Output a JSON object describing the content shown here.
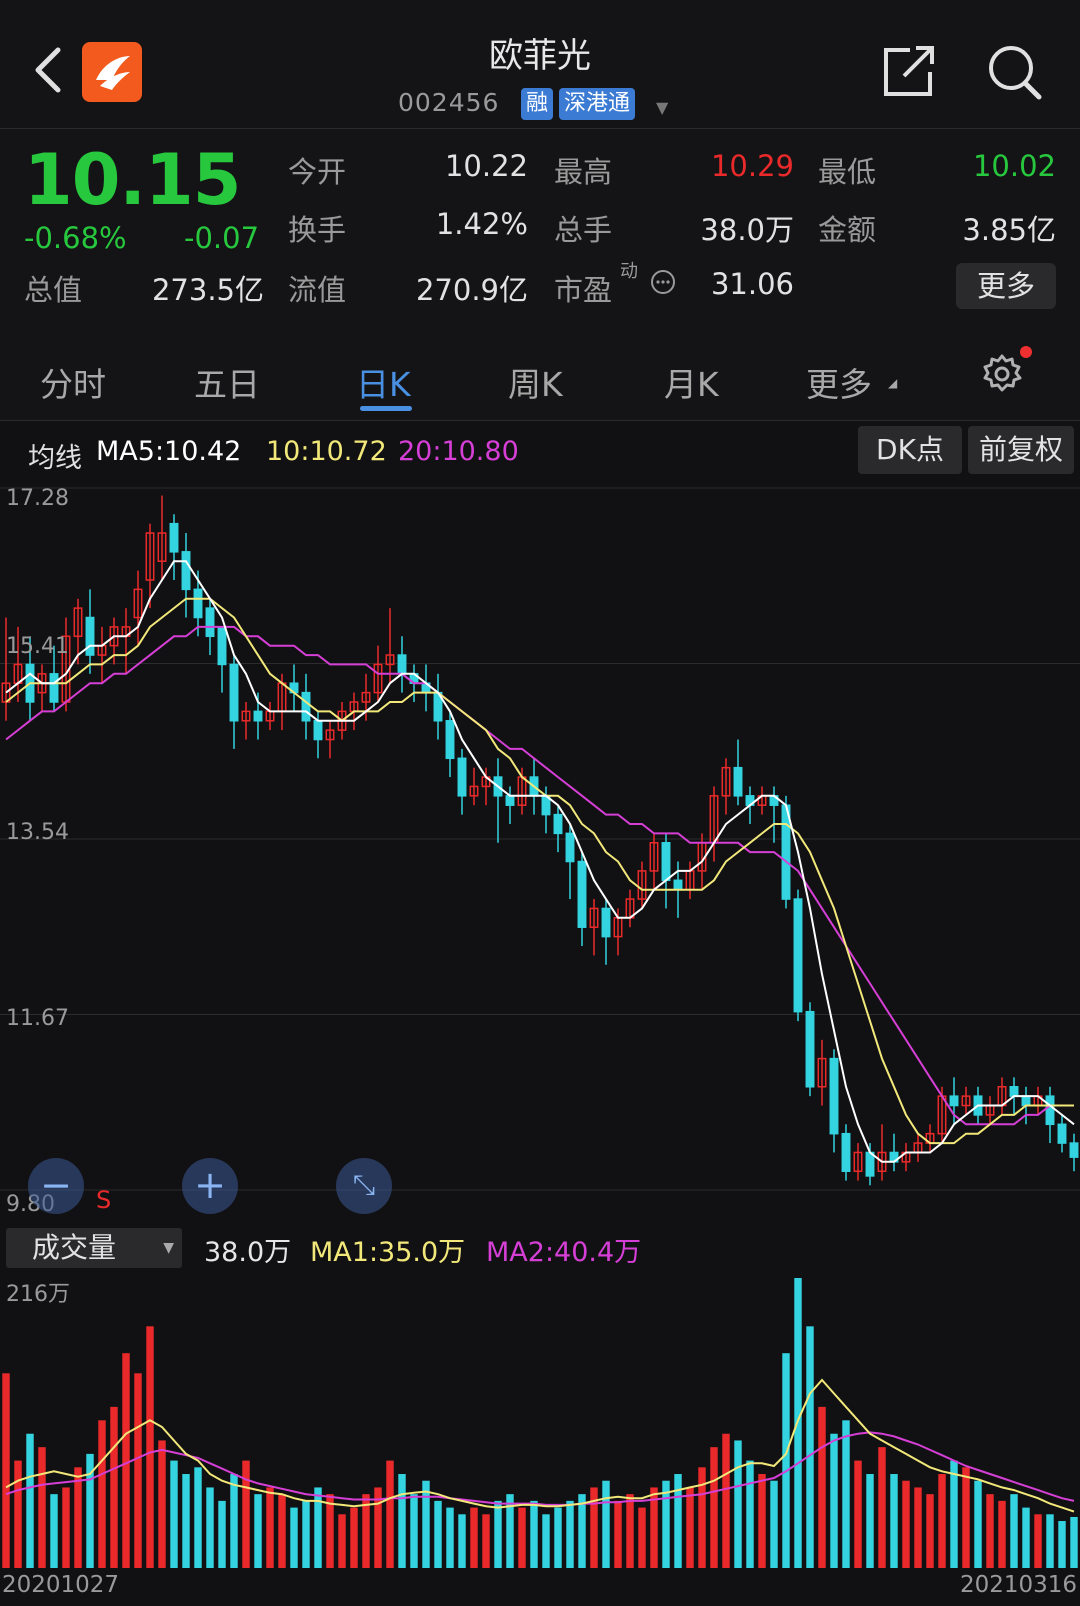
{
  "header": {
    "title": "欧菲光",
    "code": "002456",
    "tags": [
      "融",
      "深港通"
    ],
    "icons": [
      "back-arrow-icon",
      "app-logo-icon",
      "share-icon",
      "search-icon"
    ]
  },
  "quote": {
    "price": "10.15",
    "change_pct": "-0.68%",
    "change": "-0.07",
    "fields": {
      "open_label": "今开",
      "open": "10.22",
      "high_label": "最高",
      "high": "10.29",
      "low_label": "最低",
      "low": "10.02",
      "turnover_label": "换手",
      "turnover": "1.42%",
      "volume_label": "总手",
      "volume": "38.0万",
      "amount_label": "金额",
      "amount": "3.85亿",
      "mcap_label": "总值",
      "mcap": "273.5亿",
      "float_label": "流值",
      "float": "270.9亿",
      "pe_label": "市盈",
      "pe_sup": "动",
      "pe": "31.06"
    },
    "more_label": "更多"
  },
  "tabs": {
    "items": [
      "分时",
      "五日",
      "日K",
      "周K",
      "月K",
      "更多"
    ],
    "active": "日K"
  },
  "ma": {
    "label": "均线",
    "ma5": "MA5:10.42",
    "ma10": "10:10.72",
    "ma20": "20:10.80",
    "dk_label": "DK点",
    "adj_label": "前复权"
  },
  "colors": {
    "up": "#ea2a2a",
    "down": "#33d3e0",
    "ma5": "#ffffff",
    "ma10": "#f2e87a",
    "ma20": "#d63fd6",
    "price_down": "#27c83e"
  },
  "chart_data": [
    {
      "type": "candlestick",
      "y_ticks": [
        "17.28",
        "15.41",
        "13.54",
        "11.67",
        "9.80"
      ],
      "ylim": [
        9.8,
        17.28
      ],
      "candles": [
        [
          15.0,
          15.9,
          15.2,
          14.8
        ],
        [
          15.2,
          15.8,
          15.4,
          15.0
        ],
        [
          15.4,
          15.7,
          15.0,
          14.8
        ],
        [
          15.1,
          15.4,
          15.3,
          14.9
        ],
        [
          15.3,
          15.6,
          15.0,
          14.9
        ],
        [
          15.0,
          15.9,
          15.7,
          14.9
        ],
        [
          15.7,
          16.1,
          16.0,
          15.4
        ],
        [
          15.9,
          16.2,
          15.5,
          15.3
        ],
        [
          15.5,
          15.8,
          15.6,
          15.2
        ],
        [
          15.6,
          15.9,
          15.8,
          15.4
        ],
        [
          15.7,
          16.0,
          15.8,
          15.3
        ],
        [
          15.9,
          16.4,
          16.2,
          15.6
        ],
        [
          16.3,
          16.9,
          16.8,
          16.0
        ],
        [
          16.5,
          17.2,
          16.8,
          16.3
        ],
        [
          16.9,
          17.0,
          16.6,
          16.3
        ],
        [
          16.6,
          16.8,
          16.2,
          15.9
        ],
        [
          16.2,
          16.4,
          15.9,
          15.7
        ],
        [
          16.0,
          16.1,
          15.7,
          15.5
        ],
        [
          15.8,
          15.8,
          15.4,
          15.1
        ],
        [
          15.4,
          15.5,
          14.8,
          14.5
        ],
        [
          14.8,
          15.0,
          14.9,
          14.6
        ],
        [
          14.9,
          15.1,
          14.8,
          14.6
        ],
        [
          14.8,
          15.0,
          14.9,
          14.7
        ],
        [
          14.9,
          15.3,
          15.2,
          14.7
        ],
        [
          15.2,
          15.4,
          15.1,
          14.9
        ],
        [
          15.1,
          15.3,
          14.8,
          14.6
        ],
        [
          14.8,
          14.9,
          14.6,
          14.4
        ],
        [
          14.6,
          14.8,
          14.7,
          14.4
        ],
        [
          14.7,
          15.0,
          14.9,
          14.6
        ],
        [
          14.9,
          15.1,
          15.0,
          14.7
        ],
        [
          15.0,
          15.3,
          15.1,
          14.8
        ],
        [
          15.1,
          15.6,
          15.4,
          15.0
        ],
        [
          15.4,
          16.0,
          15.5,
          15.2
        ],
        [
          15.5,
          15.7,
          15.3,
          15.1
        ],
        [
          15.3,
          15.4,
          15.2,
          15.0
        ],
        [
          15.2,
          15.4,
          15.1,
          14.9
        ],
        [
          15.1,
          15.3,
          14.8,
          14.6
        ],
        [
          14.8,
          14.9,
          14.4,
          14.2
        ],
        [
          14.4,
          14.5,
          14.0,
          13.8
        ],
        [
          14.0,
          14.3,
          14.1,
          13.9
        ],
        [
          14.1,
          14.3,
          14.2,
          13.9
        ],
        [
          14.2,
          14.4,
          14.0,
          13.5
        ],
        [
          14.0,
          14.1,
          13.9,
          13.7
        ],
        [
          13.9,
          14.3,
          14.2,
          13.8
        ],
        [
          14.2,
          14.4,
          14.0,
          13.8
        ],
        [
          14.0,
          14.1,
          13.8,
          13.6
        ],
        [
          13.8,
          13.9,
          13.6,
          13.4
        ],
        [
          13.6,
          13.7,
          13.3,
          12.9
        ],
        [
          13.3,
          13.4,
          12.6,
          12.4
        ],
        [
          12.6,
          12.9,
          12.8,
          12.3
        ],
        [
          12.8,
          12.9,
          12.5,
          12.2
        ],
        [
          12.5,
          12.8,
          12.7,
          12.3
        ],
        [
          12.7,
          13.0,
          12.9,
          12.6
        ],
        [
          12.9,
          13.3,
          13.2,
          12.8
        ],
        [
          13.2,
          13.6,
          13.5,
          13.0
        ],
        [
          13.5,
          13.6,
          13.1,
          12.8
        ],
        [
          13.1,
          13.3,
          13.0,
          12.7
        ],
        [
          13.0,
          13.3,
          13.2,
          12.9
        ],
        [
          13.2,
          13.6,
          13.5,
          13.0
        ],
        [
          13.5,
          14.1,
          14.0,
          13.3
        ],
        [
          14.0,
          14.4,
          14.3,
          13.8
        ],
        [
          14.3,
          14.6,
          14.0,
          13.9
        ],
        [
          14.0,
          14.1,
          13.9,
          13.7
        ],
        [
          13.9,
          14.1,
          14.0,
          13.8
        ],
        [
          14.0,
          14.1,
          13.9,
          13.5
        ],
        [
          13.9,
          14.0,
          12.9,
          12.8
        ],
        [
          12.9,
          13.0,
          11.7,
          11.6
        ],
        [
          11.7,
          11.8,
          10.9,
          10.8
        ],
        [
          10.9,
          11.4,
          11.2,
          10.7
        ],
        [
          11.2,
          11.3,
          10.4,
          10.2
        ],
        [
          10.4,
          10.5,
          10.0,
          9.9
        ],
        [
          10.0,
          10.3,
          10.2,
          9.9
        ],
        [
          10.2,
          10.3,
          9.95,
          9.85
        ],
        [
          10.0,
          10.5,
          10.2,
          9.9
        ],
        [
          10.2,
          10.4,
          10.1,
          10.0
        ],
        [
          10.1,
          10.3,
          10.2,
          10.0
        ],
        [
          10.2,
          10.4,
          10.3,
          10.1
        ],
        [
          10.3,
          10.5,
          10.4,
          10.2
        ],
        [
          10.4,
          10.9,
          10.8,
          10.3
        ],
        [
          10.8,
          11.0,
          10.7,
          10.5
        ],
        [
          10.7,
          10.9,
          10.8,
          10.6
        ],
        [
          10.8,
          10.9,
          10.6,
          10.5
        ],
        [
          10.6,
          10.8,
          10.7,
          10.5
        ],
        [
          10.7,
          11.0,
          10.9,
          10.6
        ],
        [
          10.9,
          11.0,
          10.8,
          10.6
        ],
        [
          10.8,
          10.9,
          10.7,
          10.5
        ],
        [
          10.7,
          10.9,
          10.8,
          10.6
        ],
        [
          10.8,
          10.9,
          10.5,
          10.3
        ],
        [
          10.5,
          10.6,
          10.3,
          10.2
        ],
        [
          10.3,
          10.4,
          10.15,
          10.0
        ]
      ],
      "ma5": [
        15.1,
        15.2,
        15.3,
        15.2,
        15.2,
        15.3,
        15.5,
        15.6,
        15.6,
        15.7,
        15.7,
        15.8,
        16.1,
        16.3,
        16.5,
        16.5,
        16.3,
        16.1,
        15.9,
        15.5,
        15.3,
        15.0,
        14.9,
        14.9,
        14.9,
        14.9,
        14.8,
        14.8,
        14.8,
        14.8,
        14.9,
        15.0,
        15.2,
        15.3,
        15.3,
        15.2,
        15.1,
        14.9,
        14.6,
        14.4,
        14.2,
        14.1,
        14.0,
        14.0,
        14.0,
        14.0,
        13.9,
        13.7,
        13.4,
        13.1,
        12.9,
        12.7,
        12.7,
        12.8,
        13.0,
        13.1,
        13.2,
        13.2,
        13.3,
        13.5,
        13.7,
        13.8,
        13.9,
        14.0,
        14.0,
        13.9,
        13.4,
        12.8,
        12.1,
        11.5,
        10.9,
        10.5,
        10.2,
        10.1,
        10.1,
        10.2,
        10.2,
        10.2,
        10.3,
        10.5,
        10.6,
        10.7,
        10.7,
        10.7,
        10.8,
        10.8,
        10.8,
        10.7,
        10.6,
        10.5
      ],
      "ma10": [
        15.0,
        15.1,
        15.2,
        15.2,
        15.2,
        15.2,
        15.3,
        15.4,
        15.4,
        15.5,
        15.5,
        15.6,
        15.8,
        15.9,
        16.0,
        16.1,
        16.1,
        16.1,
        16.0,
        15.9,
        15.7,
        15.5,
        15.3,
        15.2,
        15.1,
        15.0,
        14.9,
        14.9,
        14.8,
        14.9,
        14.9,
        14.9,
        15.0,
        15.0,
        15.1,
        15.1,
        15.1,
        15.0,
        14.9,
        14.8,
        14.7,
        14.5,
        14.4,
        14.2,
        14.1,
        14.0,
        14.0,
        13.9,
        13.7,
        13.6,
        13.4,
        13.3,
        13.1,
        13.0,
        13.0,
        13.0,
        13.0,
        13.0,
        13.0,
        13.1,
        13.3,
        13.4,
        13.5,
        13.6,
        13.7,
        13.7,
        13.6,
        13.4,
        13.1,
        12.8,
        12.4,
        12.0,
        11.6,
        11.2,
        10.9,
        10.6,
        10.4,
        10.3,
        10.3,
        10.3,
        10.4,
        10.4,
        10.5,
        10.6,
        10.6,
        10.7,
        10.7,
        10.7,
        10.7,
        10.7
      ],
      "ma20": [
        14.6,
        14.7,
        14.8,
        14.9,
        14.9,
        15.0,
        15.1,
        15.2,
        15.2,
        15.3,
        15.3,
        15.4,
        15.5,
        15.6,
        15.7,
        15.7,
        15.8,
        15.8,
        15.8,
        15.8,
        15.7,
        15.7,
        15.6,
        15.6,
        15.6,
        15.5,
        15.5,
        15.4,
        15.4,
        15.4,
        15.4,
        15.3,
        15.3,
        15.3,
        15.2,
        15.2,
        15.1,
        15.0,
        14.9,
        14.8,
        14.7,
        14.6,
        14.5,
        14.5,
        14.4,
        14.3,
        14.2,
        14.1,
        14.0,
        13.9,
        13.8,
        13.8,
        13.7,
        13.7,
        13.6,
        13.6,
        13.6,
        13.5,
        13.5,
        13.5,
        13.5,
        13.5,
        13.4,
        13.4,
        13.4,
        13.3,
        13.2,
        13.0,
        12.8,
        12.6,
        12.4,
        12.2,
        12.0,
        11.8,
        11.6,
        11.4,
        11.2,
        11.0,
        10.8,
        10.6,
        10.5,
        10.5,
        10.5,
        10.5,
        10.5,
        10.6,
        10.6,
        10.7,
        10.7,
        10.7
      ]
    },
    {
      "type": "bar",
      "title": "成交量",
      "current": "38.0万",
      "ma1": "MA1:35.0万",
      "ma2": "MA2:40.4万",
      "y_max_label": "216万",
      "ylim": [
        0,
        216
      ],
      "x_start_label": "20201027",
      "x_end_label": "20210316",
      "volumes": [
        145,
        80,
        100,
        90,
        55,
        60,
        75,
        85,
        110,
        120,
        160,
        145,
        180,
        95,
        80,
        70,
        75,
        60,
        50,
        70,
        80,
        55,
        60,
        55,
        45,
        50,
        60,
        55,
        40,
        45,
        55,
        60,
        80,
        70,
        55,
        65,
        50,
        45,
        40,
        45,
        40,
        50,
        55,
        45,
        50,
        40,
        45,
        50,
        55,
        60,
        65,
        50,
        55,
        45,
        60,
        65,
        70,
        60,
        75,
        90,
        100,
        95,
        80,
        70,
        65,
        160,
        216,
        180,
        120,
        100,
        110,
        80,
        70,
        90,
        70,
        65,
        60,
        55,
        70,
        80,
        75,
        65,
        55,
        50,
        55,
        45,
        40,
        40,
        35,
        38
      ],
      "vol_ma1": [
        60,
        65,
        68,
        70,
        72,
        70,
        68,
        70,
        80,
        90,
        100,
        105,
        110,
        105,
        95,
        85,
        80,
        70,
        65,
        62,
        60,
        58,
        56,
        55,
        52,
        50,
        50,
        48,
        47,
        46,
        47,
        48,
        52,
        55,
        56,
        57,
        55,
        52,
        50,
        48,
        46,
        45,
        46,
        47,
        47,
        46,
        46,
        47,
        48,
        50,
        52,
        53,
        52,
        52,
        55,
        56,
        58,
        60,
        62,
        65,
        70,
        75,
        78,
        78,
        76,
        85,
        110,
        130,
        140,
        130,
        120,
        110,
        100,
        95,
        90,
        85,
        80,
        75,
        72,
        70,
        68,
        66,
        63,
        60,
        58,
        55,
        52,
        48,
        45,
        42
      ],
      "vol_ma2": [
        55,
        58,
        60,
        62,
        63,
        64,
        65,
        66,
        70,
        74,
        78,
        82,
        86,
        88,
        86,
        84,
        82,
        78,
        74,
        70,
        66,
        63,
        61,
        59,
        57,
        55,
        54,
        53,
        52,
        51,
        51,
        51,
        52,
        52,
        53,
        53,
        53,
        52,
        51,
        50,
        49,
        48,
        48,
        48,
        48,
        47,
        47,
        47,
        48,
        48,
        49,
        49,
        50,
        50,
        51,
        52,
        53,
        54,
        55,
        57,
        59,
        61,
        63,
        65,
        67,
        72,
        78,
        84,
        90,
        95,
        98,
        100,
        101,
        100,
        98,
        95,
        92,
        88,
        84,
        80,
        76,
        73,
        70,
        67,
        64,
        61,
        58,
        55,
        52,
        50
      ]
    }
  ]
}
